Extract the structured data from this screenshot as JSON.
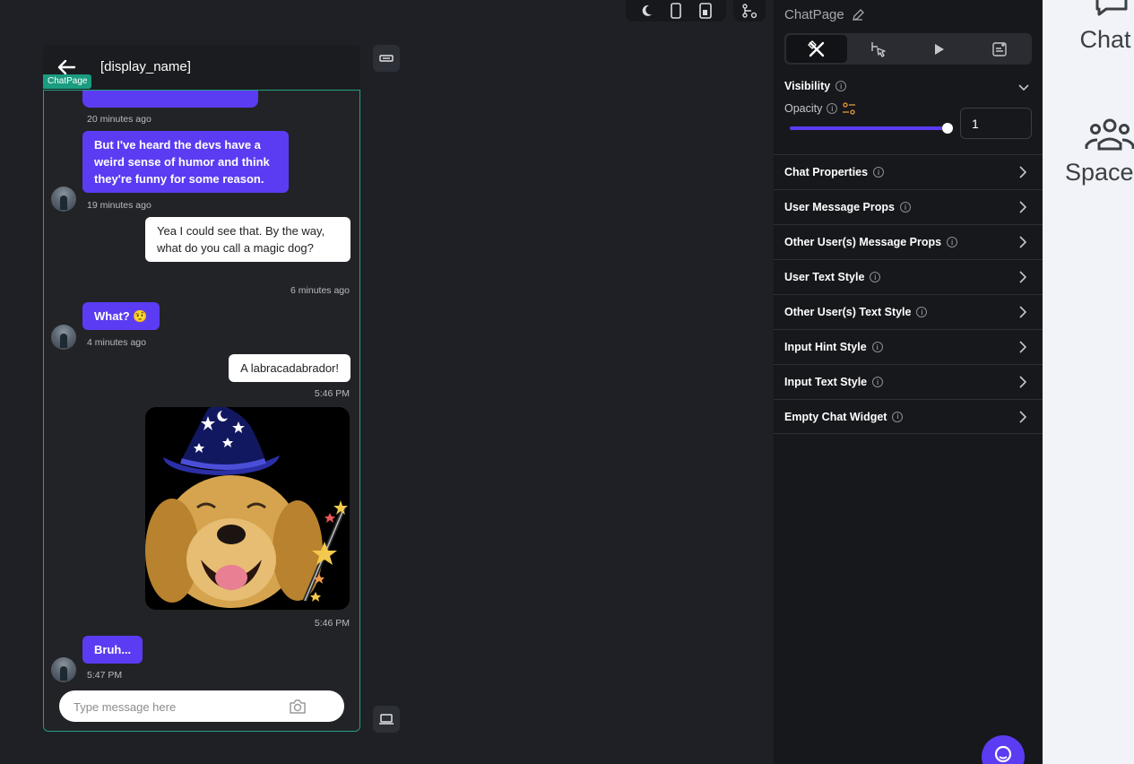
{
  "toolbar": {
    "icons": [
      "theme-moon-icon",
      "phone-device-icon",
      "tablet-device-icon",
      "widget-tree-icon"
    ]
  },
  "phone": {
    "header_title": "[display_name]",
    "page_tag": "ChatPage",
    "messages": [
      {
        "sender": "other",
        "text": "",
        "time": "20 minutes ago"
      },
      {
        "sender": "other",
        "text": "But I've heard the devs have a weird sense of humor and think they're funny for some reason.",
        "time": "19 minutes ago"
      },
      {
        "sender": "me",
        "text": "Yea I could see that. By the way, what do you call a magic dog?",
        "time": "6 minutes ago"
      },
      {
        "sender": "other",
        "text": "What? 🤨",
        "time": "4 minutes ago"
      },
      {
        "sender": "me",
        "text": "A labracadabrador!",
        "time": "5:46 PM"
      },
      {
        "sender": "me",
        "image": "wizard-dog",
        "time": "5:46 PM"
      },
      {
        "sender": "other",
        "text": "Bruh...",
        "time": "5:47 PM"
      }
    ],
    "input_placeholder": "Type message here"
  },
  "panel": {
    "title": "ChatPage",
    "tabs": [
      "properties-tab",
      "actions-tab",
      "preview-tab",
      "notes-tab"
    ],
    "visibility_label": "Visibility",
    "opacity_label": "Opacity",
    "opacity_value": "1",
    "opacity_fraction": 1,
    "sections": [
      "Chat Properties",
      "User Message Props",
      "Other User(s) Message Props",
      "User Text Style",
      "Other User(s) Text Style",
      "Input Hint Style",
      "Input Text Style",
      "Empty Chat Widget"
    ]
  },
  "rail": {
    "items": [
      {
        "icon": "chat-bubble-icon",
        "label": "Chat"
      },
      {
        "icon": "people-group-icon",
        "label": "Spaces"
      }
    ]
  },
  "colors": {
    "accent": "#5b3cf2",
    "frame": "#22a085",
    "panel_bg": "#17181c",
    "canvas_bg": "#1e2025"
  }
}
